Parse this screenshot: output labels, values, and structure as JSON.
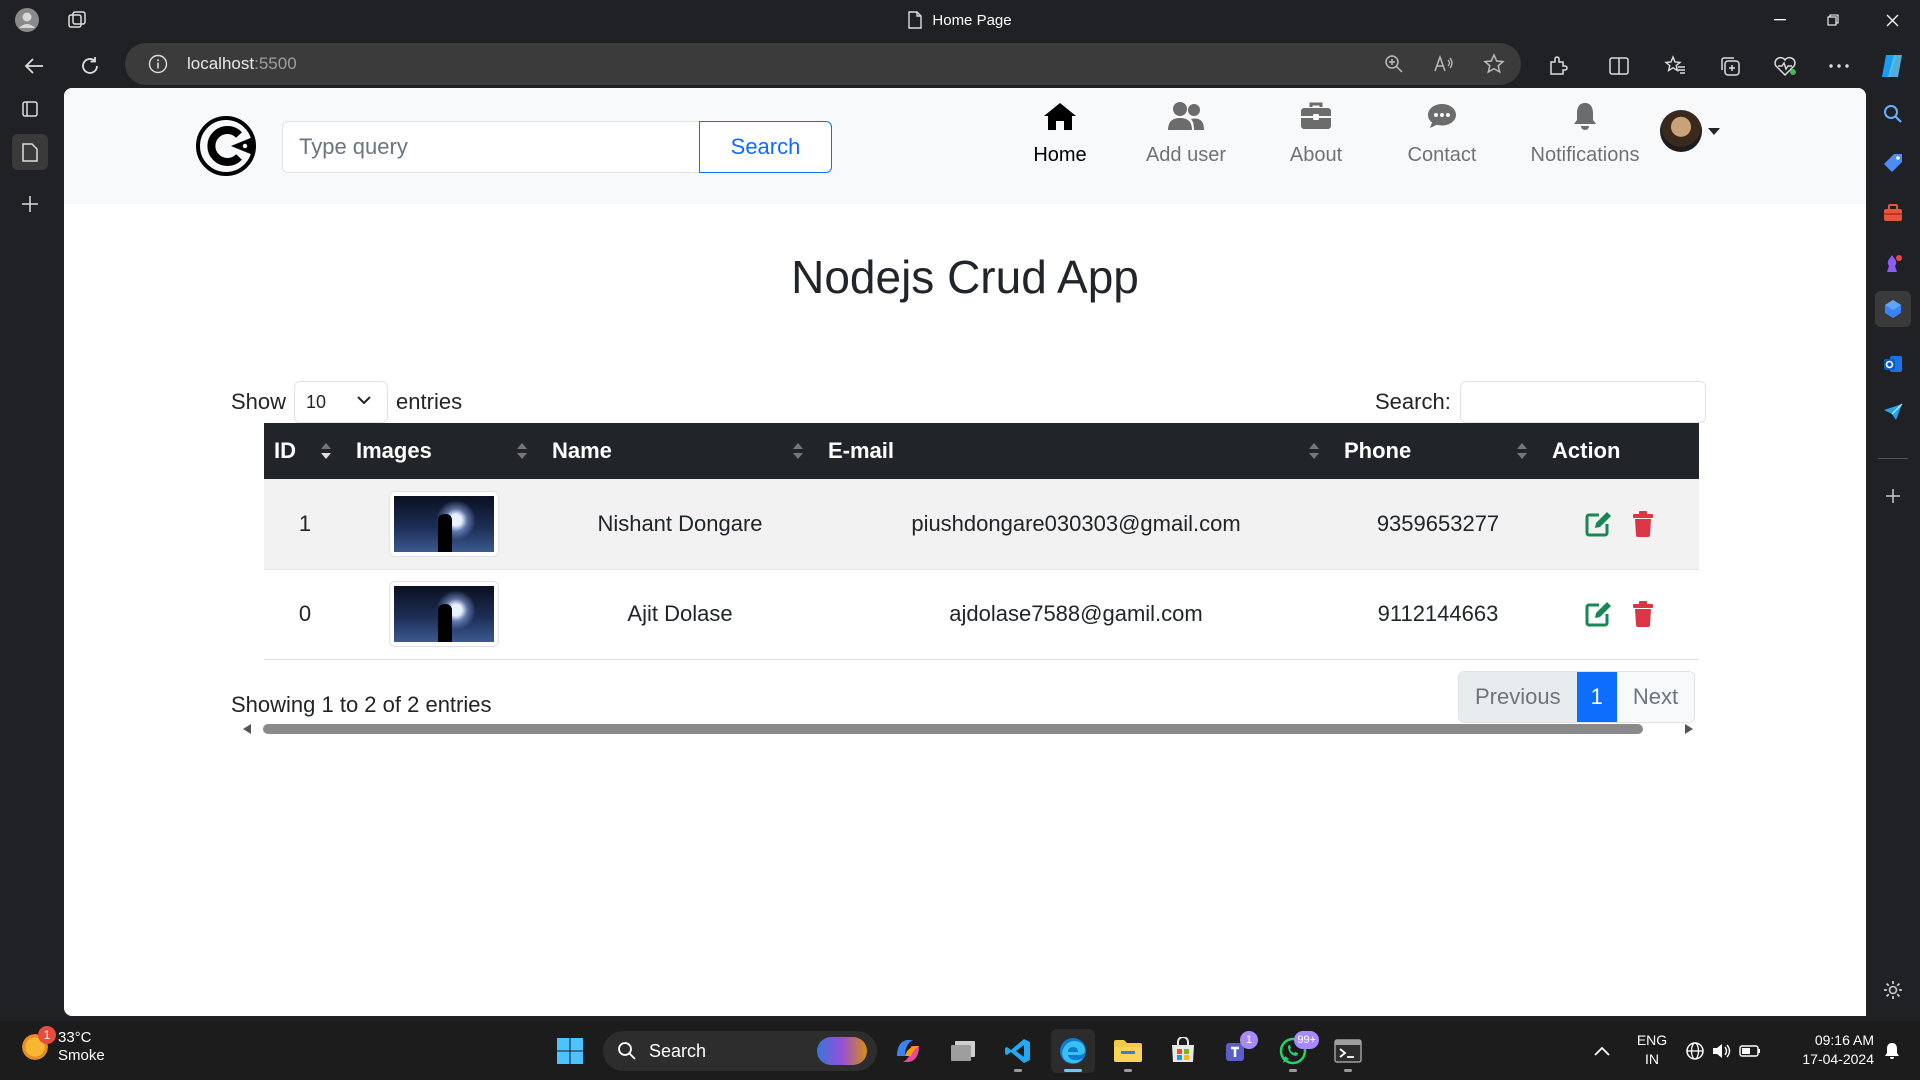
{
  "browser": {
    "tab_title": "Home Page",
    "url_host": "localhost",
    "url_port": ":5500"
  },
  "navbar": {
    "search_placeholder": "Type query",
    "search_button": "Search",
    "items": [
      {
        "label": "Home",
        "icon": "house-icon",
        "active": true
      },
      {
        "label": "Add user",
        "icon": "users-icon",
        "active": false
      },
      {
        "label": "About",
        "icon": "briefcase-icon",
        "active": false
      },
      {
        "label": "Contact",
        "icon": "chat-icon",
        "active": false
      },
      {
        "label": "Notifications",
        "icon": "bell-icon",
        "active": false
      }
    ]
  },
  "page": {
    "title": "Nodejs Crud App",
    "show_label": "Show",
    "entries_value": "10",
    "entries_label": "entries",
    "filter_label": "Search:",
    "info": "Showing 1 to 2 of 2 entries"
  },
  "table": {
    "columns": [
      "ID",
      "Images",
      "Name",
      "E-mail",
      "Phone",
      "Action"
    ],
    "rows": [
      {
        "id": "1",
        "name": "Nishant Dongare",
        "email": "piushdongare030303@gmail.com",
        "phone": "9359653277"
      },
      {
        "id": "0",
        "name": "Ajit Dolase",
        "email": "ajdolase7588@gamil.com",
        "phone": "9112144663"
      }
    ]
  },
  "pagination": {
    "previous": "Previous",
    "current": "1",
    "next": "Next"
  },
  "taskbar": {
    "weather_badge": "1",
    "temperature": "33°C",
    "condition": "Smoke",
    "search_label": "Search",
    "teams_badge": "1",
    "whatsapp_badge": "99+",
    "lang_line1": "ENG",
    "lang_line2": "IN",
    "time": "09:16 AM",
    "date": "17-04-2024"
  },
  "colors": {
    "primary": "#0d6efd",
    "table_header": "#212529",
    "edit": "#198754",
    "delete": "#dc3545"
  }
}
